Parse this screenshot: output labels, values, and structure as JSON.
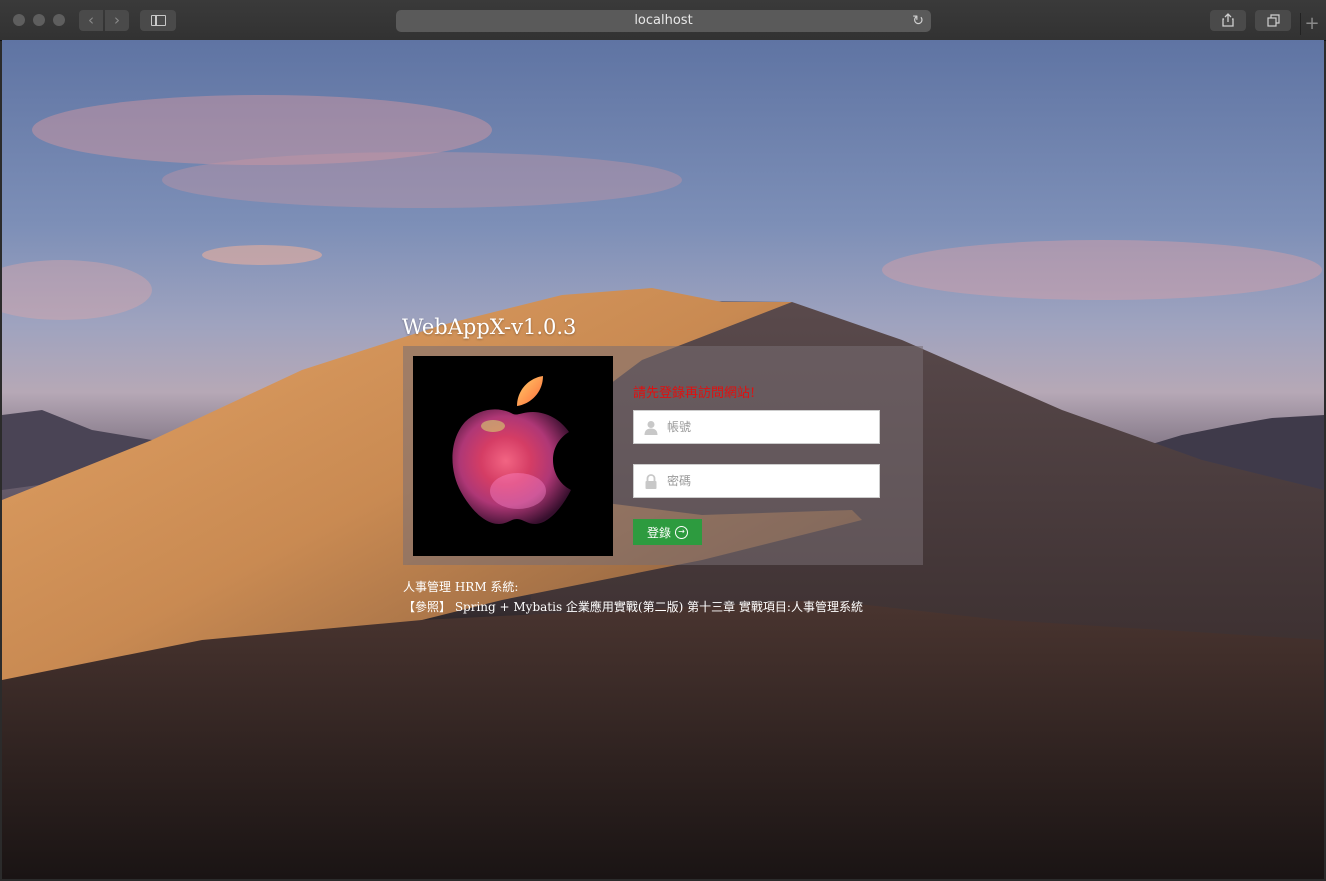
{
  "browser": {
    "url": "localhost",
    "back_icon": "chevron-left-icon",
    "forward_icon": "chevron-right-icon",
    "reload_icon": "reload-icon",
    "share_icon": "share-icon",
    "tabs_icon": "tabs-overview-icon",
    "newtab_icon": "plus-icon"
  },
  "login": {
    "app_title": "WebAppX-v1.0.3",
    "error_message": "請先登錄再訪問網站!",
    "username_placeholder": "帳號",
    "password_placeholder": "密碼",
    "login_button": "登錄",
    "user_icon": "user-icon",
    "lock_icon": "lock-icon",
    "login_icon": "arrow-circle-right-icon",
    "logo_icon": "apple-logo-icon",
    "button_color": "#2d9b3f",
    "error_color": "#e01010"
  },
  "footer": {
    "title": "人事管理 HRM 系統:",
    "reference": "【參照】 Spring + Mybatis 企業應用實戰(第二版) 第十三章 實戰項目:人事管理系統"
  }
}
